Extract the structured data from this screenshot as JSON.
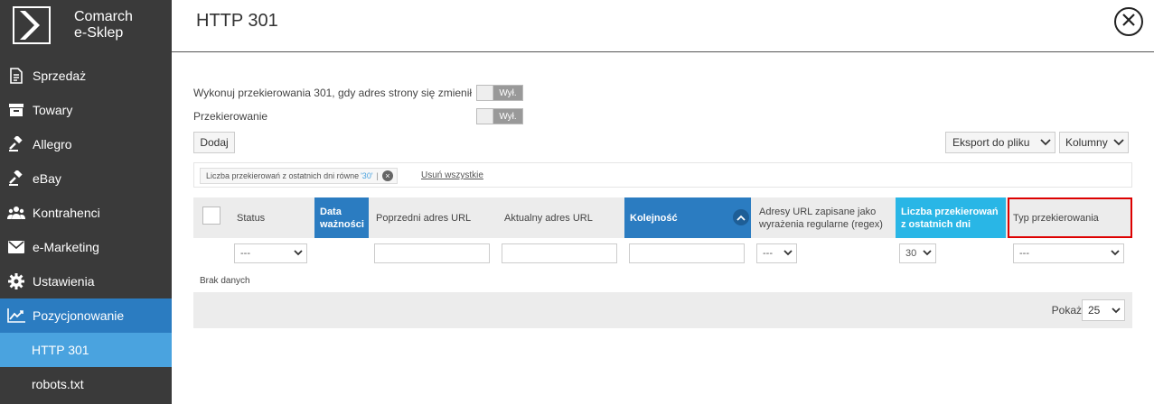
{
  "sidebar": {
    "logo": {
      "line1": "Comarch",
      "line2": "e-Sklep"
    },
    "items": [
      {
        "label": "Sprzedaż",
        "icon": "document-icon"
      },
      {
        "label": "Towary",
        "icon": "box-icon"
      },
      {
        "label": "Allegro",
        "icon": "gavel-icon"
      },
      {
        "label": "eBay",
        "icon": "gavel-icon"
      },
      {
        "label": "Kontrahenci",
        "icon": "users-icon"
      },
      {
        "label": "e-Marketing",
        "icon": "envelope-icon"
      },
      {
        "label": "Ustawienia",
        "icon": "gear-icon"
      },
      {
        "label": "Pozycjonowanie",
        "icon": "chart-line-icon"
      }
    ],
    "subitems": [
      {
        "label": "HTTP 301"
      },
      {
        "label": "robots.txt"
      }
    ]
  },
  "header": {
    "title": "HTTP 301"
  },
  "options": {
    "redirect_label": "Wykonuj przekierowania 301, gdy adres strony się zmienił",
    "redirect_toggle": "Wył.",
    "przekierowanie_label": "Przekierowanie",
    "przekierowanie_toggle": "Wył."
  },
  "toolbar": {
    "add_label": "Dodaj",
    "export_label": "Eksport do pliku",
    "columns_label": "Kolumny"
  },
  "filter": {
    "chip_text": "Liczba przekierowań z ostatnich dni równe",
    "chip_value": "'30'",
    "chip_sep": "|",
    "remove_all": "Usuń wszystkie"
  },
  "table": {
    "columns": [
      {
        "label": "Status"
      },
      {
        "label": "Data ważności"
      },
      {
        "label": "Poprzedni adres URL"
      },
      {
        "label": "Aktualny adres URL"
      },
      {
        "label": "Kolejność"
      },
      {
        "label": "Adresy URL zapisane jako wyrażenia regularne (regex)"
      },
      {
        "label": "Liczba przekierowań z ostatnich dni"
      },
      {
        "label": "Typ przekierowania"
      }
    ],
    "filters": {
      "status": "---",
      "regex": "---",
      "days": "30",
      "type": "---"
    },
    "empty_text": "Brak danych"
  },
  "pagination": {
    "show_label": "Pokaż",
    "page_size": "25"
  },
  "colors": {
    "sidebar_bg": "#3a3a3a",
    "active_blue": "#2b7cc1",
    "sub_active": "#4aa3df",
    "cyan": "#29b6e6",
    "highlight": "#dd0000"
  }
}
